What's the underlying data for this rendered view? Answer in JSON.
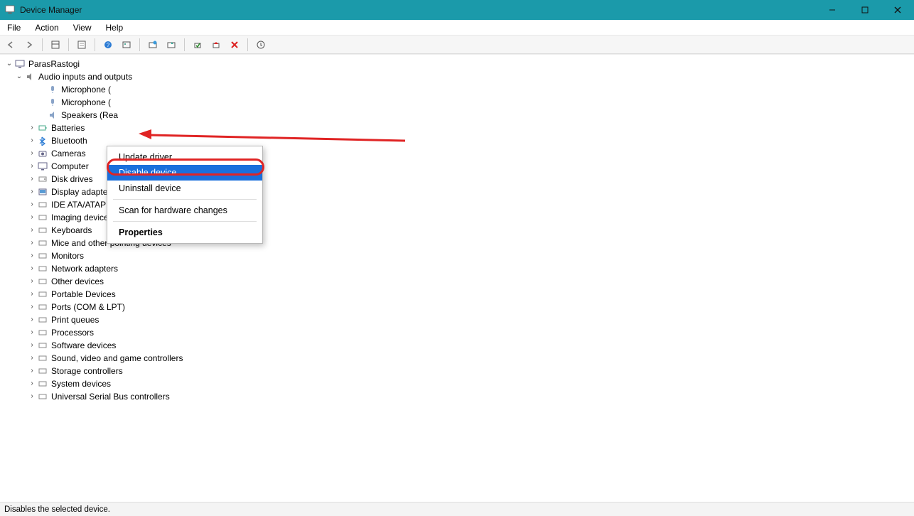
{
  "title": "Device Manager",
  "menubar": [
    "File",
    "Action",
    "View",
    "Help"
  ],
  "toolbar_icons": [
    "back",
    "forward",
    "up",
    "show-hide-console",
    "properties",
    "help",
    "print",
    "scan",
    "update",
    "enable",
    "disable",
    "uninstall"
  ],
  "root": "ParasRastogi",
  "audio_category": "Audio inputs and outputs",
  "audio_children": [
    "Microphone (",
    "Microphone (",
    "Speakers (Rea"
  ],
  "categories": [
    "Batteries",
    "Bluetooth",
    "Cameras",
    "Computer",
    "Disk drives",
    "Display adapters",
    "IDE ATA/ATAPI controllers",
    "Imaging devices",
    "Keyboards",
    "Mice and other pointing devices",
    "Monitors",
    "Network adapters",
    "Other devices",
    "Portable Devices",
    "Ports (COM & LPT)",
    "Print queues",
    "Processors",
    "Software devices",
    "Sound, video and game controllers",
    "Storage controllers",
    "System devices",
    "Universal Serial Bus controllers"
  ],
  "context": {
    "update": "Update driver",
    "disable": "Disable device",
    "uninstall": "Uninstall device",
    "scan": "Scan for hardware changes",
    "properties": "Properties"
  },
  "status": "Disables the selected device."
}
